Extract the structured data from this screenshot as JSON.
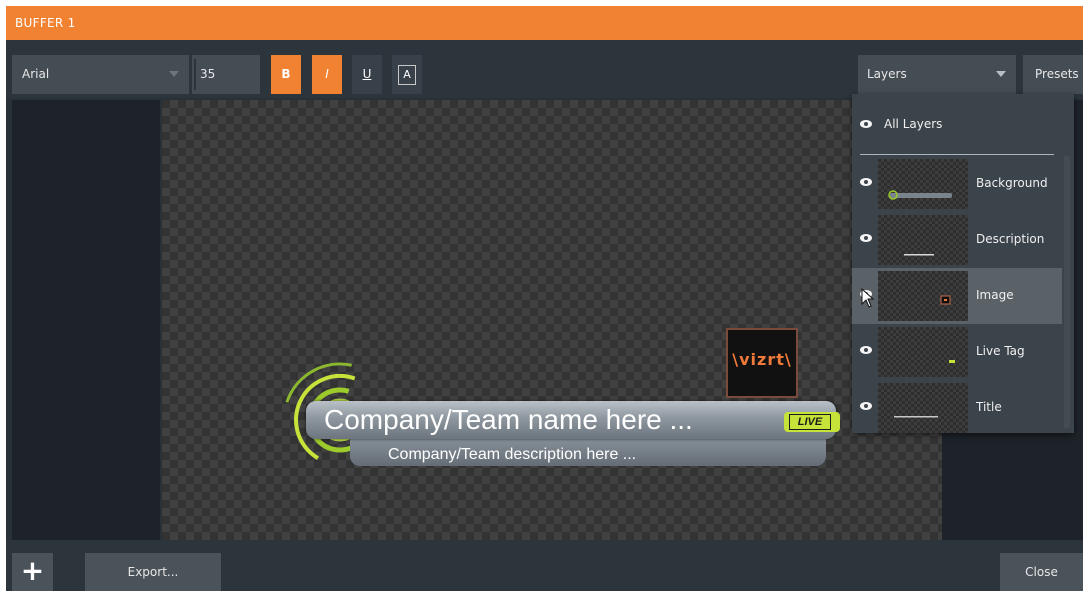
{
  "window": {
    "title": "BUFFER 1"
  },
  "toolbar": {
    "font": "Arial",
    "size": "35",
    "bold_label": "B",
    "italic_label": "I",
    "underline_label": "U",
    "color_label": "A",
    "layers_label": "Layers",
    "presets_label": "Presets"
  },
  "canvas": {
    "company_name": "Company/Team name here ...",
    "company_desc": "Company/Team description here ...",
    "live_tag": "LIVE",
    "logo": "\\vizrt\\"
  },
  "layers": {
    "all_label": "All Layers",
    "items": [
      {
        "label": "Background"
      },
      {
        "label": "Description"
      },
      {
        "label": "Image"
      },
      {
        "label": "Live Tag"
      },
      {
        "label": "Title"
      }
    ],
    "selected": "Image"
  },
  "bottom": {
    "add_label": "+",
    "export_label": "Export...",
    "close_label": "Close"
  },
  "colors": {
    "accent": "#f08232",
    "live_green": "#c6e33a",
    "ring_green": "#9ccc2c"
  }
}
